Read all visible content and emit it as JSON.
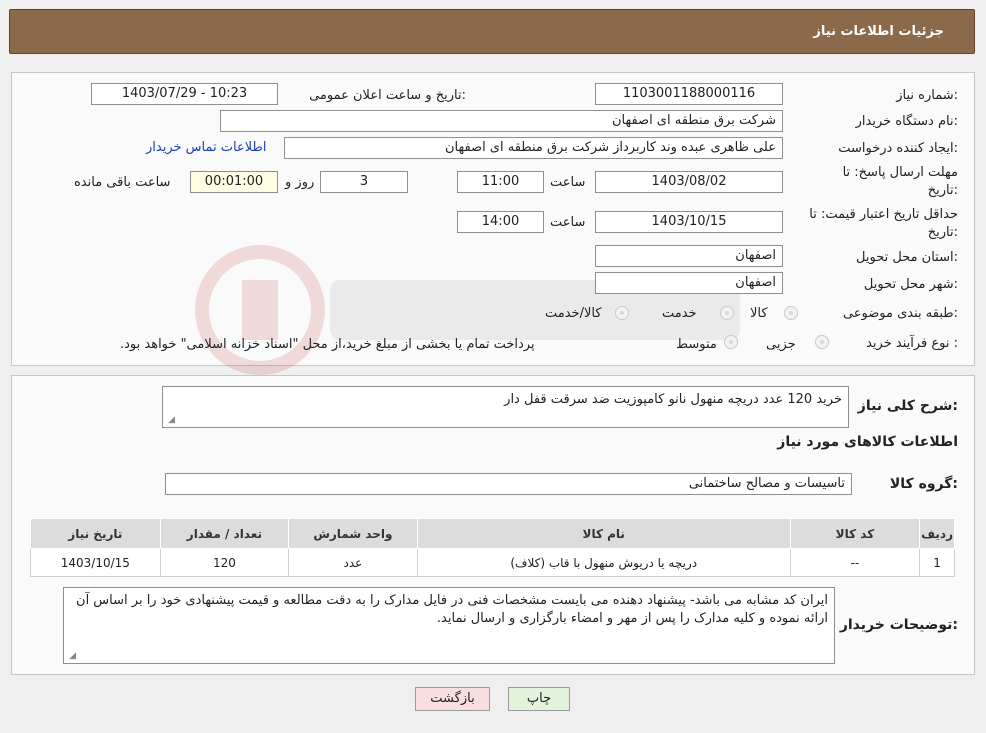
{
  "header": {
    "title": "جزئیات اطلاعات نیاز"
  },
  "form": {
    "need_number_label": "شماره نیاز:",
    "need_number": "1103001188000116",
    "announce_label": "تاریخ و ساعت اعلان عمومی:",
    "announce_value": "1403/07/29 - 10:23",
    "buyer_org_label": "نام دستگاه خریدار:",
    "buyer_org": "شرکت برق منطقه ای اصفهان",
    "requester_label": "ایجاد کننده درخواست:",
    "requester": "علی ظاهری عبده وند کاربرداز شرکت برق منطقه ای اصفهان",
    "contact_link": "اطلاعات تماس خریدار",
    "deadline_label_1": "مهلت ارسال پاسخ: تا",
    "deadline_label_2": "تاریخ:",
    "deadline_date": "1403/08/02",
    "time_label": "ساعت",
    "deadline_time": "11:00",
    "days": "3",
    "days_label": "روز و",
    "remaining": "00:01:00",
    "remaining_label": "ساعت باقی مانده",
    "validity_label_1": "حداقل تاریخ اعتبار قیمت: تا",
    "validity_label_2": "تاریخ:",
    "validity_date": "1403/10/15",
    "validity_time": "14:00",
    "province_label": "استان محل تحویل:",
    "province": "اصفهان",
    "city_label": "شهر محل تحویل:",
    "city": "اصفهان",
    "category_label": "طبقه بندی موضوعی:",
    "category_options": [
      "کالا",
      "خدمت",
      "کالا/خدمت"
    ],
    "process_label": "نوع فرآیند خرید :",
    "process_options": [
      "جزیی",
      "متوسط"
    ],
    "process_note": "پرداخت تمام یا بخشی از مبلغ خرید،از محل \"اسناد خزانه اسلامی\" خواهد بود."
  },
  "details": {
    "summary_label": "شرح کلی نیاز:",
    "summary": "خرید 120 عدد دریچه منهول نانو کامپوزیت ضد سرقت قفل دار",
    "goods_info_title": "اطلاعات کالاهای مورد نیاز",
    "group_label": "گروه کالا:",
    "group": "تاسیسات و مصالح ساختمانی",
    "table": {
      "headers": [
        "ردیف",
        "کد کالا",
        "نام کالا",
        "واحد شمارش",
        "تعداد / مقدار",
        "تاریخ نیاز"
      ],
      "rows": [
        [
          "1",
          "--",
          "دریچه یا دریوش منهول با قاب (کلاف)",
          "عدد",
          "120",
          "1403/10/15"
        ]
      ]
    },
    "buyer_notes_label": "توضیحات خریدار:",
    "buyer_notes": "ایران کد مشابه می باشد- پیشنهاد دهنده می بایست مشخصات فنی در فایل مدارک  را به دقت مطالعه و قیمت پیشنهادی خود را بر اساس آن ارائه نموده و کلیه مدارک را پس از مهر و امضاء بارگزاری و ارسال نماید."
  },
  "buttons": {
    "back": "بازگشت",
    "print": "چاپ"
  },
  "colors": {
    "header": "#8a6a4a",
    "back_button": "#f8dede",
    "print_button": "#e2f3dc",
    "link": "#1a3fb6"
  }
}
